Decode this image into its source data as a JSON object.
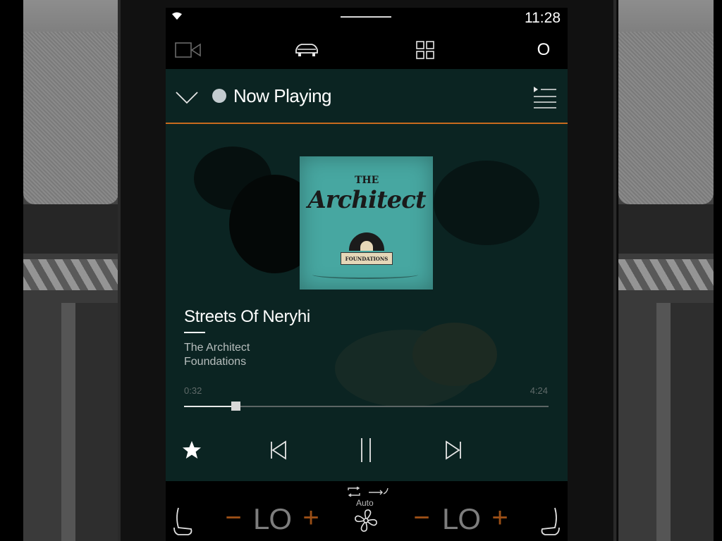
{
  "status_bar": {
    "time": "11:28"
  },
  "top_nav": {
    "profile_label": "O"
  },
  "now_playing": {
    "header_title": "Now Playing",
    "album_art": {
      "word_the": "THE",
      "word_title": "Architect",
      "banner": "FOUNDATIONS"
    },
    "song_title": "Streets Of Neryhi",
    "artist": "The Architect",
    "album": "Foundations",
    "elapsed": "0:32",
    "duration": "4:24",
    "progress_fraction": 0.13
  },
  "climate": {
    "left_temp": "LO",
    "right_temp": "LO",
    "minus_symbol": "−",
    "plus_symbol": "+",
    "fan_mode": "Auto"
  },
  "colors": {
    "accent": "#c76a1e",
    "temp_adjust": "#9b4f16",
    "content_bg": "#0b2422"
  }
}
